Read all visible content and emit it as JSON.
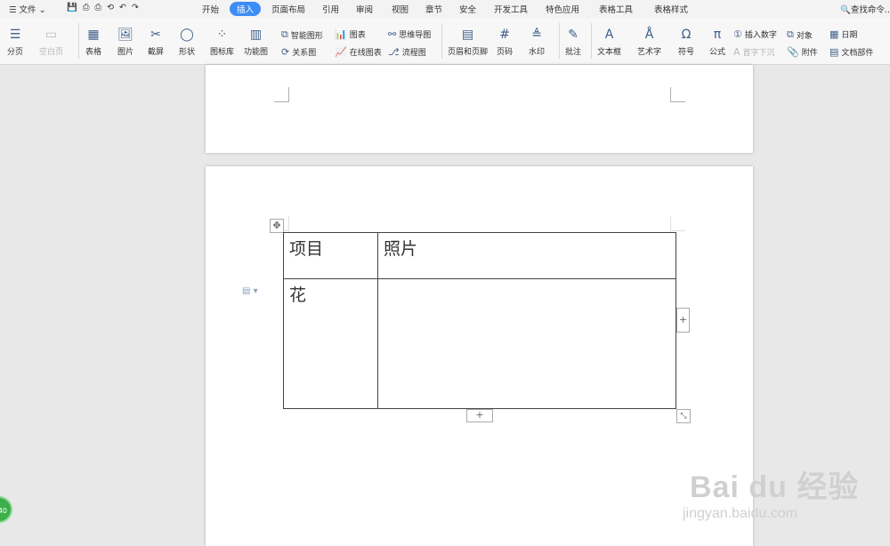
{
  "menu": {
    "file": "文件",
    "tabs": [
      "开始",
      "插入",
      "页面布局",
      "引用",
      "审阅",
      "视图",
      "章节",
      "安全",
      "开发工具",
      "特色应用",
      "表格工具",
      "表格样式"
    ],
    "active_tab": "插入",
    "search": "查找命令..."
  },
  "ribbon": {
    "page_break": "分页",
    "blank_page": "空白页",
    "table": "表格",
    "picture": "图片",
    "screenshot": "截屏",
    "shape": "形状",
    "icon_library": "图标库",
    "function_chart": "功能图",
    "smart_graphic": "智能图形",
    "chart": "图表",
    "mind_map": "思维导图",
    "relation_chart": "关系图",
    "online_chart": "在线图表",
    "flowchart": "流程图",
    "header_footer": "页眉和页脚",
    "page_number": "页码",
    "watermark": "水印",
    "comment": "批注",
    "textbox": "文本框",
    "wordart": "艺术字",
    "symbol": "符号",
    "formula": "公式",
    "insert_number": "插入数字",
    "drop_cap": "首字下沉",
    "object": "对象",
    "attachment": "附件",
    "date": "日期",
    "doc_parts": "文档部件"
  },
  "table": {
    "header": [
      "项目",
      "照片"
    ],
    "row1": [
      "花",
      ""
    ]
  },
  "watermark": {
    "brand": "Bai du 经验",
    "url": "jingyan.baidu.com"
  },
  "badge": "40"
}
